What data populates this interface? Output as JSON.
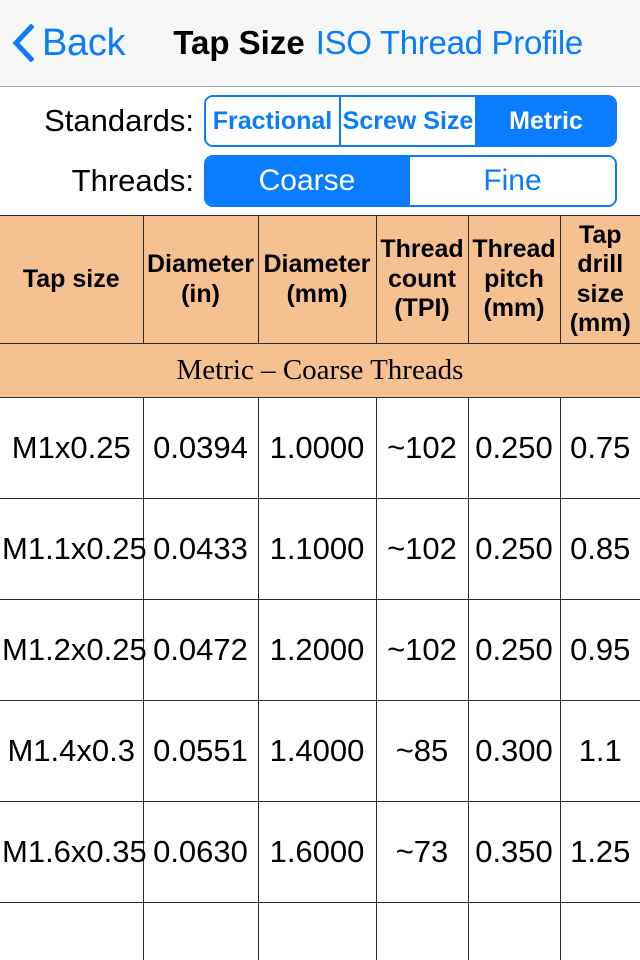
{
  "navbar": {
    "back_label": "Back",
    "back_icon": "chevron-left-icon",
    "title": "Tap Size",
    "subtitle": "ISO Thread Profile"
  },
  "colors": {
    "accent": "#0a7cff",
    "header_fill": "#f6c190",
    "navbar_bg": "#f7f7f7",
    "grid_line": "#2b2b2b"
  },
  "filters": [
    {
      "label": "Standards:",
      "options": [
        "Fractional",
        "Screw Size",
        "Metric"
      ],
      "selected": "Metric"
    },
    {
      "label": "Threads:",
      "options": [
        "Coarse",
        "Fine"
      ],
      "selected": "Coarse"
    }
  ],
  "table": {
    "columns": [
      "Tap size",
      "Diameter (in)",
      "Diameter (mm)",
      "Thread count (TPI)",
      "Thread pitch (mm)",
      "Tap drill size (mm)"
    ],
    "column_lines": [
      [
        "Tap size"
      ],
      [
        "Diameter",
        "(in)"
      ],
      [
        "Diameter",
        "(mm)"
      ],
      [
        "Thread",
        "count",
        "(TPI)"
      ],
      [
        "Thread",
        "pitch",
        "(mm)"
      ],
      [
        "Tap",
        "drill",
        "size",
        "(mm)"
      ]
    ],
    "section_title": "Metric – Coarse Threads",
    "rows": [
      {
        "tap_size": "M1x0.25",
        "diameter_in": "0.0394",
        "diameter_mm": "1.0000",
        "thread_count_tpi": "~102",
        "thread_pitch_mm": "0.250",
        "tap_drill_size_mm": "0.75"
      },
      {
        "tap_size": "M1.1x0.25",
        "diameter_in": "0.0433",
        "diameter_mm": "1.1000",
        "thread_count_tpi": "~102",
        "thread_pitch_mm": "0.250",
        "tap_drill_size_mm": "0.85"
      },
      {
        "tap_size": "M1.2x0.25",
        "diameter_in": "0.0472",
        "diameter_mm": "1.2000",
        "thread_count_tpi": "~102",
        "thread_pitch_mm": "0.250",
        "tap_drill_size_mm": "0.95"
      },
      {
        "tap_size": "M1.4x0.3",
        "diameter_in": "0.0551",
        "diameter_mm": "1.4000",
        "thread_count_tpi": "~85",
        "thread_pitch_mm": "0.300",
        "tap_drill_size_mm": "1.1"
      },
      {
        "tap_size": "M1.6x0.35",
        "diameter_in": "0.0630",
        "diameter_mm": "1.6000",
        "thread_count_tpi": "~73",
        "thread_pitch_mm": "0.350",
        "tap_drill_size_mm": "1.25"
      }
    ]
  }
}
